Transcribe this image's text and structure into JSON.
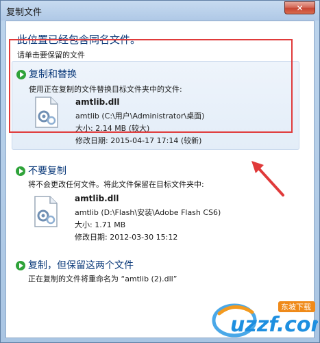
{
  "window": {
    "title": "复制文件",
    "close_glyph": "✕"
  },
  "header": {
    "title": "此位置已经包含同名文件。",
    "subtitle": "请单击要保留的文件"
  },
  "options": [
    {
      "title": "复制和替换",
      "description": "使用正在复制的文件替换目标文件夹中的文件:",
      "file": {
        "name": "amtlib.dll",
        "location": "amtlib (C:\\用户\\Administrator\\桌面)",
        "size": "大小: 2.14 MB (较大)",
        "modified": "修改日期: 2015-04-17 17:14 (较新)"
      }
    },
    {
      "title": "不要复制",
      "description": "将不会更改任何文件。将此文件保留在目标文件夹中:",
      "file": {
        "name": "amtlib.dll",
        "location": "amtlib (D:\\Flash\\安装\\Adobe Flash CS6)",
        "size": "大小: 1.71 MB",
        "modified": "修改日期: 2012-03-30 15:12"
      }
    },
    {
      "title": "复制，但保留这两个文件",
      "description": "正在复制的文件将重命名为 “amtlib (2).dll”"
    }
  ],
  "watermark": {
    "brand": "uzzf.com",
    "tag": "东坡下载"
  },
  "colors": {
    "accent": "#0b3a7a",
    "highlight": "#e03a3a",
    "arrow_green": "#2fa33a"
  },
  "icons": [
    "close-icon",
    "green-arrow-icon",
    "dll-file-icon"
  ]
}
